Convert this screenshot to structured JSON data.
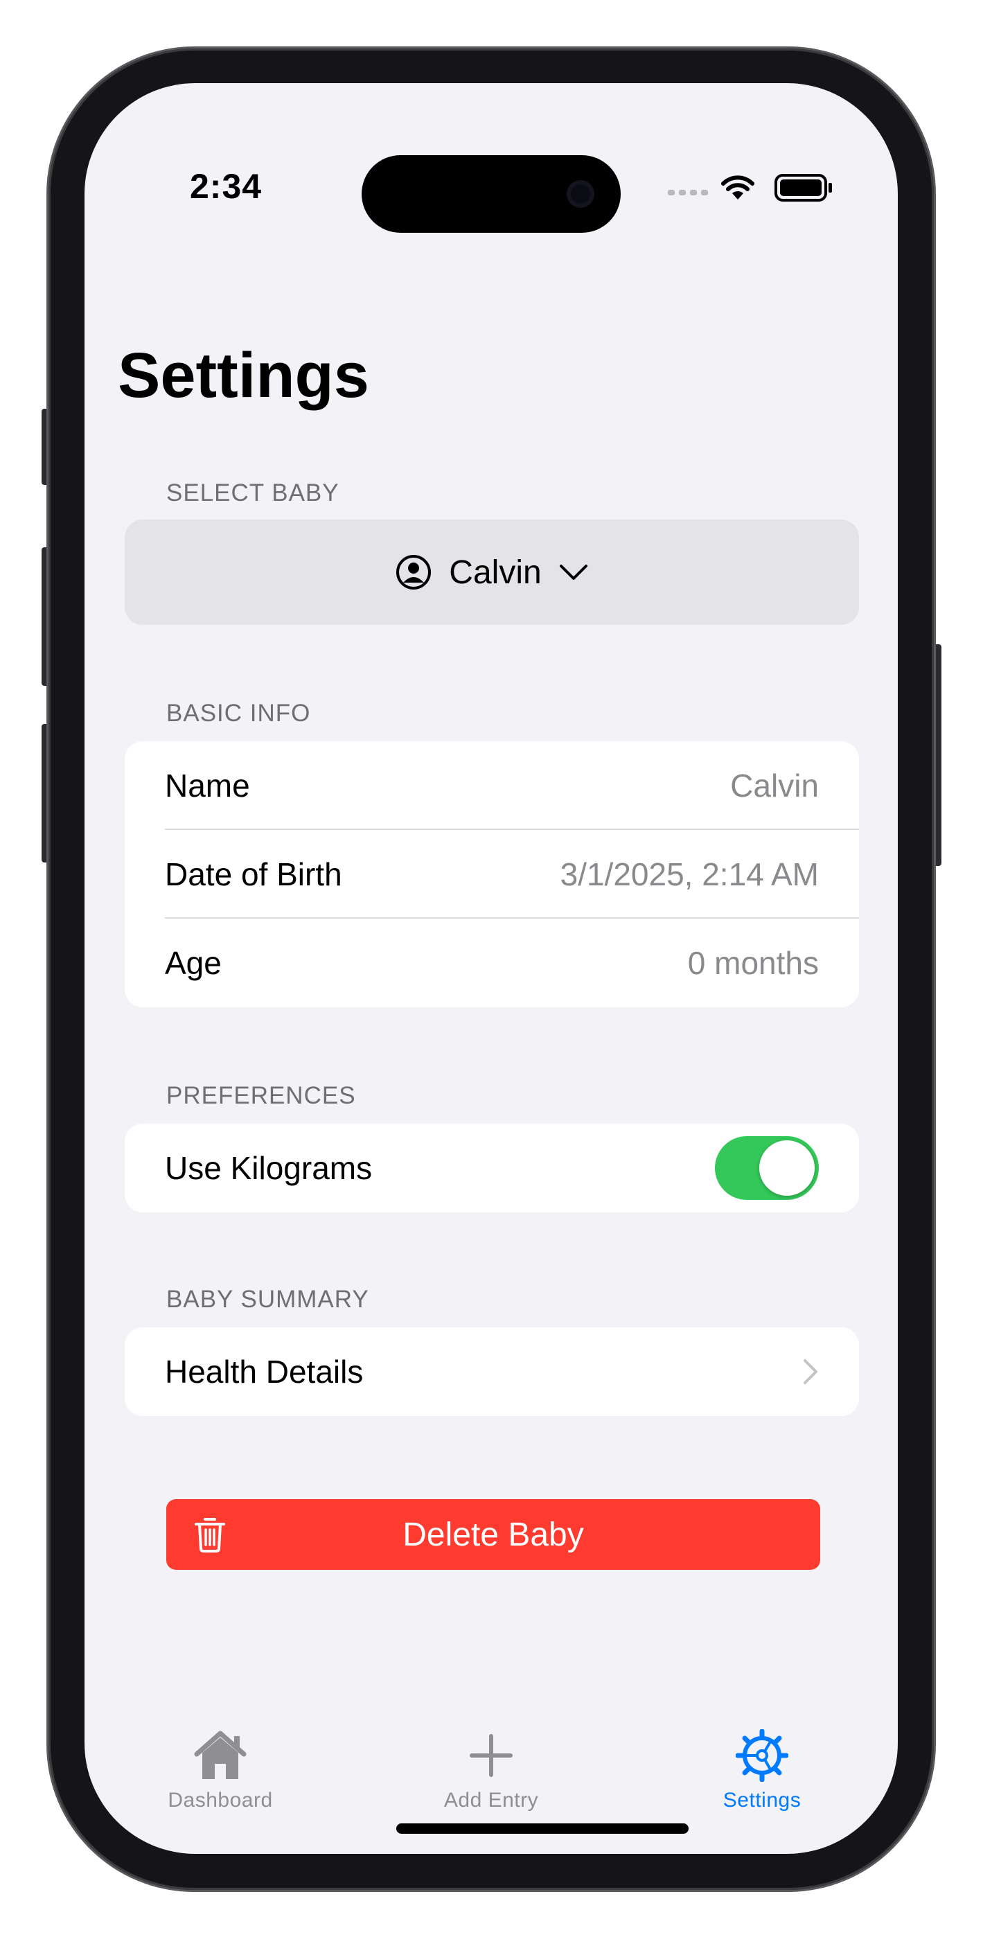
{
  "status_bar": {
    "time": "2:34"
  },
  "header": {
    "title": "Settings"
  },
  "select_baby": {
    "section_label": "SELECT BABY",
    "selected_name": "Calvin"
  },
  "basic_info": {
    "section_label": "BASIC INFO",
    "rows": [
      {
        "label": "Name",
        "value": "Calvin"
      },
      {
        "label": "Date of Birth",
        "value": "3/1/2025, 2:14 AM"
      },
      {
        "label": "Age",
        "value": "0 months"
      }
    ]
  },
  "preferences": {
    "section_label": "PREFERENCES",
    "use_kilograms_label": "Use Kilograms",
    "use_kilograms_on": true
  },
  "baby_summary": {
    "section_label": "BABY SUMMARY",
    "health_details_label": "Health Details"
  },
  "delete": {
    "label": "Delete Baby"
  },
  "tab_bar": {
    "tabs": [
      {
        "label": "Dashboard",
        "icon": "house-icon",
        "active": false
      },
      {
        "label": "Add Entry",
        "icon": "plus-icon",
        "active": false
      },
      {
        "label": "Settings",
        "icon": "gear-icon",
        "active": true
      }
    ]
  },
  "colors": {
    "accent": "#007aff",
    "toggle_on": "#34c759",
    "destructive": "#ff3b30",
    "background": "#f2f2f7"
  }
}
